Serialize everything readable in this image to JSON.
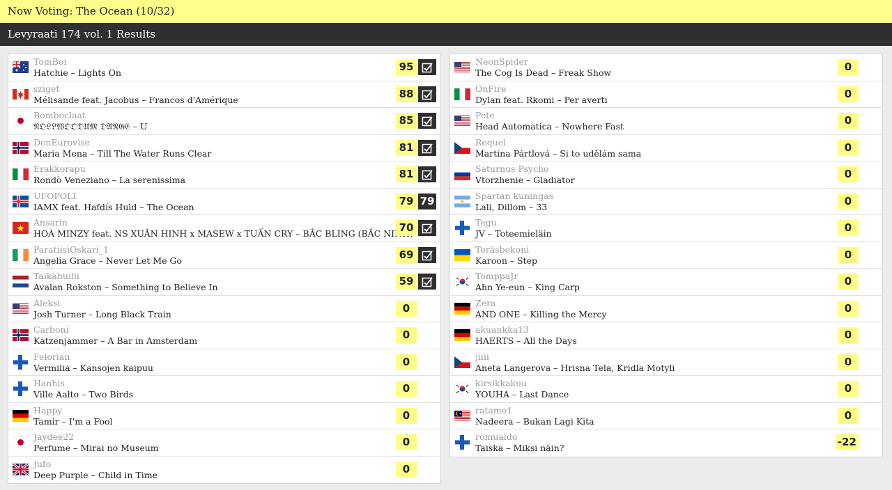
{
  "header": {
    "now_voting": "Now Voting: The Ocean (10/32)"
  },
  "subheader": {
    "title": "Levyraati 174 vol. 1 Results"
  },
  "colors": {
    "accent_yellow": "#fdfd8a",
    "dark": "#2f2f2f"
  },
  "left_rows": [
    {
      "user": "TomBoi",
      "song": "Hatchie – Lights On",
      "score": "95",
      "flag": "au",
      "mark": "check"
    },
    {
      "user": "sziget",
      "song": "Mélisande feat. Jacobus – Francos d'Amérique",
      "score": "88",
      "flag": "ca",
      "mark": "check"
    },
    {
      "user": "Bomboclaat",
      "song": "𝔑𝔒𝔏𝔏𝔚𝔒𝔒𝔇𝔘𝔐 𝔇𝔄𝔑𝔊𝔈 – U",
      "score": "85",
      "flag": "jp",
      "mark": "check"
    },
    {
      "user": "DenEurovise",
      "song": "Maria Mena – Till The Water Runs Clear",
      "score": "81",
      "flag": "no",
      "mark": "check"
    },
    {
      "user": "Erakkorapu",
      "song": "Rondò Veneziano – La serenissima",
      "score": "81",
      "flag": "it",
      "mark": "check"
    },
    {
      "user": "UFOPOLI",
      "song": "IAMX feat. Hafdís Huld – The Ocean",
      "score": "79",
      "flag": "is",
      "mark": "79"
    },
    {
      "user": "Ansarin",
      "song": "HOÀ MINZY feat. NS XUÂN HINH x MASEW x TUẤN CRY – BẮC BLING (BẮC NINH)",
      "score": "70",
      "flag": "vn",
      "mark": "check"
    },
    {
      "user": "ParatiisiOskari_1",
      "song": "Angelia Grace – Never Let Me Go",
      "score": "69",
      "flag": "ie",
      "mark": "check"
    },
    {
      "user": "Taikahuilu",
      "song": "Avalan Rokston – Something to Believe In",
      "score": "59",
      "flag": "nl",
      "mark": "check"
    },
    {
      "user": "Aleksi",
      "song": "Josh Turner – Long Black Train",
      "score": "0",
      "flag": "us",
      "mark": ""
    },
    {
      "user": "Carboni",
      "song": "Katzenjammer – A Bar in Amsterdam",
      "score": "0",
      "flag": "no",
      "mark": ""
    },
    {
      "user": "Felorian",
      "song": "Vermilia – Kansojen kaipuu",
      "score": "0",
      "flag": "fi",
      "mark": ""
    },
    {
      "user": "Hanhis",
      "song": "Ville Aalto – Two Birds",
      "score": "0",
      "flag": "fi",
      "mark": ""
    },
    {
      "user": "Happy",
      "song": "Tamir – I'm a Fool",
      "score": "0",
      "flag": "de",
      "mark": ""
    },
    {
      "user": "Jaydee22",
      "song": "Perfume – Mirai no Museum",
      "score": "0",
      "flag": "jp",
      "mark": ""
    },
    {
      "user": "Jufo",
      "song": "Deep Purple – Child in Time",
      "score": "0",
      "flag": "gb",
      "mark": ""
    }
  ],
  "right_rows": [
    {
      "user": "NeonSpider",
      "song": "The Cog Is Dead – Freak Show",
      "score": "0",
      "flag": "us",
      "mark": ""
    },
    {
      "user": "OnFire",
      "song": "Dylan feat. Rkomi – Per averti",
      "score": "0",
      "flag": "it",
      "mark": ""
    },
    {
      "user": "Pete",
      "song": "Head Automatica – Nowhere Fast",
      "score": "0",
      "flag": "us",
      "mark": ""
    },
    {
      "user": "Requel",
      "song": "Martina Pártlová – Si to udělám sama",
      "score": "0",
      "flag": "cz",
      "mark": ""
    },
    {
      "user": "Saturnus Psycho",
      "song": "Vtorzhenie – Gladiator",
      "score": "0",
      "flag": "ru",
      "mark": ""
    },
    {
      "user": "Spartan kuningas",
      "song": "Lali, Dillom – 33",
      "score": "0",
      "flag": "ar",
      "mark": ""
    },
    {
      "user": "Tegu",
      "song": "JV – Toteemieläin",
      "score": "0",
      "flag": "fi",
      "mark": ""
    },
    {
      "user": "Teräsbekoni",
      "song": "Karoon – Step",
      "score": "0",
      "flag": "ua",
      "mark": ""
    },
    {
      "user": "TomppaJr",
      "song": "Ahn Ye-eun – King Carp",
      "score": "0",
      "flag": "kr",
      "mark": ""
    },
    {
      "user": "Zera",
      "song": "AND ONE – Killing the Mercy",
      "score": "0",
      "flag": "de",
      "mark": ""
    },
    {
      "user": "akuankka13",
      "song": "HAERTS – All the Days",
      "score": "0",
      "flag": "de",
      "mark": ""
    },
    {
      "user": "jiiii",
      "song": "Aneta Langerova – Hrisna Tela, Kridla Motyli",
      "score": "0",
      "flag": "cz",
      "mark": ""
    },
    {
      "user": "kirsikkakuu",
      "song": "YOUHA – Last Dance",
      "score": "0",
      "flag": "kr",
      "mark": ""
    },
    {
      "user": "ratamo1",
      "song": "Nadeera – Bukan Lagi Kita",
      "score": "0",
      "flag": "my",
      "mark": ""
    },
    {
      "user": "romualdo",
      "song": "Taiska – Miksi näin?",
      "score": "-22",
      "flag": "fi",
      "mark": ""
    }
  ]
}
